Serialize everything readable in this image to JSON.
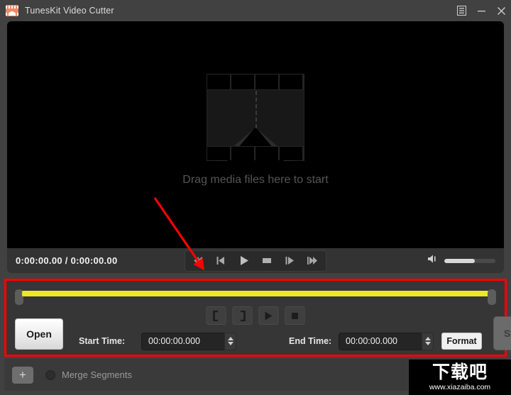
{
  "window": {
    "title": "TunesKit Video Cutter",
    "app_icon": "film-strip-icon",
    "controls": {
      "menu_label": "menu-icon",
      "minimize_label": "minimize-icon",
      "close_label": "close-icon"
    },
    "accent_color": "#ef8a62",
    "background_color": "#414141"
  },
  "player": {
    "dropzone_text": "Drag media files here to start",
    "dropzone_graphic": "film-strip-cut-icon",
    "time_readout": "0:00:00.00 / 0:00:00.00",
    "current_time": "0:00:00.00",
    "total_time": "0:00:00.00",
    "transport": [
      {
        "name": "previous-segment-button",
        "icon": "skip-back-icon"
      },
      {
        "name": "step-backward-button",
        "icon": "step-back-icon"
      },
      {
        "name": "play-button",
        "icon": "play-icon"
      },
      {
        "name": "stop-button",
        "icon": "stop-icon"
      },
      {
        "name": "step-forward-button",
        "icon": "step-forward-icon"
      },
      {
        "name": "next-segment-button",
        "icon": "skip-forward-icon"
      }
    ],
    "volume": {
      "icon": "volume-icon",
      "level_percent": 60
    }
  },
  "editor": {
    "highlight_color": "#ff0000",
    "timeline": {
      "bar_color": "#ece72c",
      "left_handle": "trim-start-handle",
      "right_handle": "trim-end-handle"
    },
    "mark_buttons": [
      {
        "name": "set-start-marker-button",
        "label": "["
      },
      {
        "name": "set-end-marker-button",
        "label": "]"
      },
      {
        "name": "preview-play-button",
        "label": "play"
      },
      {
        "name": "preview-stop-button",
        "label": "stop"
      }
    ],
    "open_label": "Open",
    "start_time_label": "Start Time:",
    "start_time_value": "00:00:00.000",
    "end_time_label": "End Time:",
    "end_time_value": "00:00:00.000",
    "format_label": "Format",
    "start_label": "Start",
    "start_enabled": false
  },
  "bottom": {
    "add_label": "+",
    "merge_label": "Merge Segments",
    "merge_checked": false
  },
  "watermark": {
    "logo": "下载吧",
    "url": "www.xiazaiba.com"
  }
}
